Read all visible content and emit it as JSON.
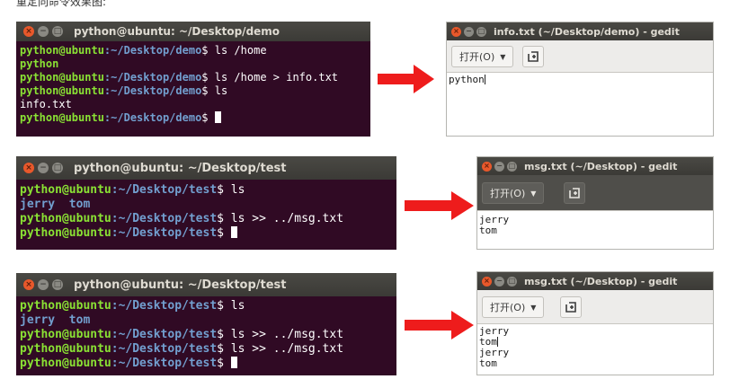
{
  "caption": "重定向命令效果图:",
  "panels": [
    {
      "terminal": {
        "title": "python@ubuntu: ~/Desktop/demo",
        "lines": [
          {
            "user": "python@ubuntu",
            "path": ":~/Desktop/demo",
            "dollar": "$",
            "cmd": " ls /home"
          },
          {
            "out": "python"
          },
          {
            "user": "python@ubuntu",
            "path": ":~/Desktop/demo",
            "dollar": "$",
            "cmd": " ls /home > info.txt"
          },
          {
            "user": "python@ubuntu",
            "path": ":~/Desktop/demo",
            "dollar": "$",
            "cmd": " ls"
          },
          {
            "out": "info.txt"
          },
          {
            "user": "python@ubuntu",
            "path": ":~/Desktop/demo",
            "dollar": "$",
            "cmd": " "
          }
        ]
      },
      "editor": {
        "title": "info.txt (~/Desktop/demo) - gedit",
        "open_label": "打开(O)",
        "lines": [
          "python"
        ]
      }
    },
    {
      "terminal": {
        "title": "python@ubuntu: ~/Desktop/test",
        "lines": [
          {
            "user": "python@ubuntu",
            "path": ":~/Desktop/test",
            "dollar": "$",
            "cmd": " ls"
          },
          {
            "out": "jerry  tom"
          },
          {
            "user": "python@ubuntu",
            "path": ":~/Desktop/test",
            "dollar": "$",
            "cmd": " ls >> ../msg.txt"
          },
          {
            "user": "python@ubuntu",
            "path": ":~/Desktop/test",
            "dollar": "$",
            "cmd": " "
          }
        ]
      },
      "editor": {
        "title": "msg.txt (~/Desktop) - gedit",
        "open_label": "打开(O)",
        "lines": [
          "jerry",
          "tom"
        ]
      }
    },
    {
      "terminal": {
        "title": "python@ubuntu: ~/Desktop/test",
        "lines": [
          {
            "user": "python@ubuntu",
            "path": ":~/Desktop/test",
            "dollar": "$",
            "cmd": " ls"
          },
          {
            "out": "jerry  tom"
          },
          {
            "user": "python@ubuntu",
            "path": ":~/Desktop/test",
            "dollar": "$",
            "cmd": " ls >> ../msg.txt"
          },
          {
            "user": "python@ubuntu",
            "path": ":~/Desktop/test",
            "dollar": "$",
            "cmd": " ls >> ../msg.txt"
          },
          {
            "user": "python@ubuntu",
            "path": ":~/Desktop/test",
            "dollar": "$",
            "cmd": " "
          }
        ]
      },
      "editor": {
        "title": "msg.txt (~/Desktop) - gedit",
        "open_label": "打开(O)",
        "lines": [
          "jerry",
          "tom",
          "jerry",
          "tom"
        ]
      }
    }
  ],
  "icons": {
    "close": "close-icon",
    "minimize": "minimize-icon",
    "maximize": "maximize-icon",
    "new_tab": "new-tab-icon",
    "dropdown": "chevron-down-icon",
    "arrow": "right-arrow-icon"
  },
  "colors": {
    "terminal_bg": "#300a24",
    "prompt_user": "#8ae234",
    "prompt_path": "#729fcf",
    "titlebar": "#3b3a36",
    "close_button": "#e8582b",
    "arrow": "#ee1c1c"
  }
}
